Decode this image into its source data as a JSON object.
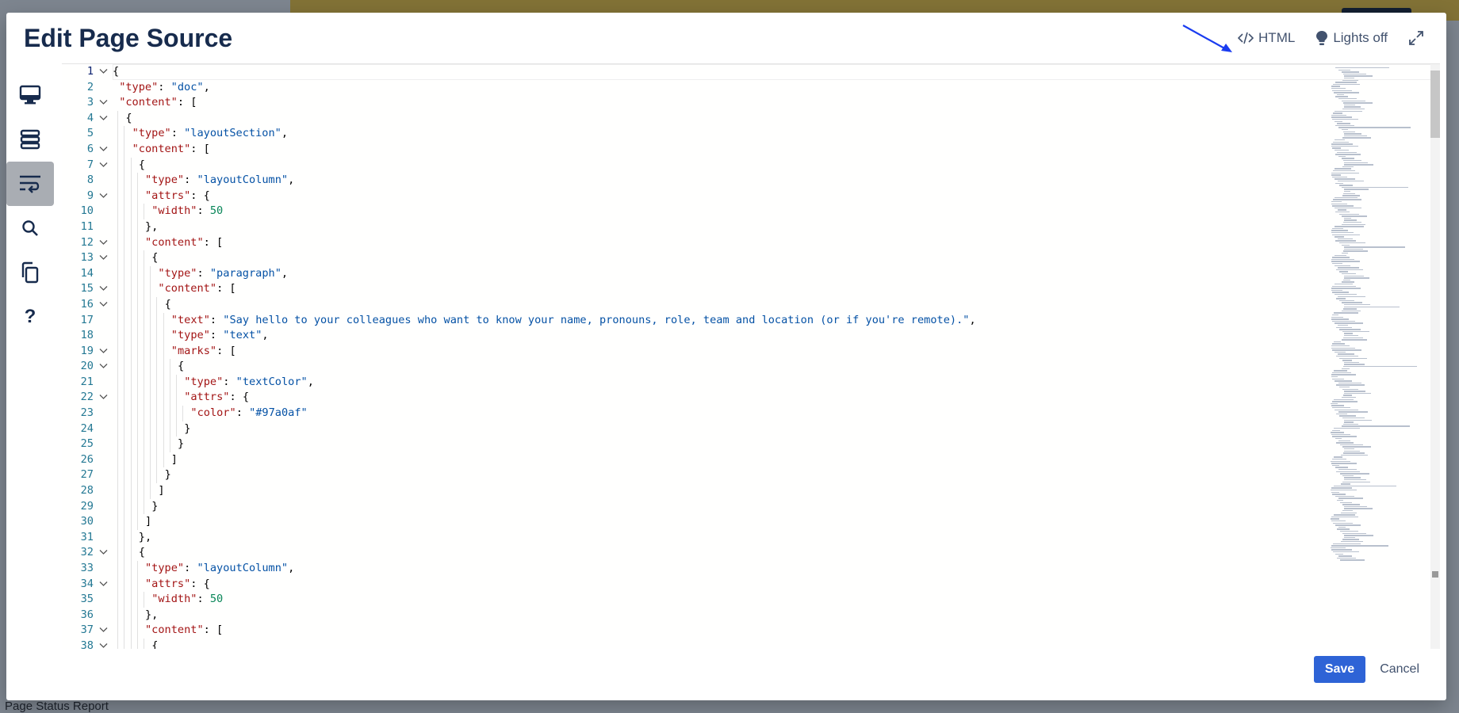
{
  "background": {
    "status_report": "Page Status Report"
  },
  "modal": {
    "title": "Edit Page Source",
    "header": {
      "html_label": "HTML",
      "lights_label": "Lights off"
    },
    "footer": {
      "save_label": "Save",
      "cancel_label": "Cancel"
    }
  },
  "toolbar": {
    "help_label": "?",
    "active_tool": "word-wrap"
  },
  "editor": {
    "current_line": 1,
    "lines": [
      {
        "n": "1",
        "fold": true,
        "text": "{"
      },
      {
        "n": "2",
        "fold": false,
        "text": "  \"type\": \"doc\","
      },
      {
        "n": "3",
        "fold": true,
        "text": "  \"content\": ["
      },
      {
        "n": "4",
        "fold": true,
        "text": "    {"
      },
      {
        "n": "5",
        "fold": false,
        "text": "      \"type\": \"layoutSection\","
      },
      {
        "n": "6",
        "fold": true,
        "text": "      \"content\": ["
      },
      {
        "n": "7",
        "fold": true,
        "text": "        {"
      },
      {
        "n": "8",
        "fold": false,
        "text": "          \"type\": \"layoutColumn\","
      },
      {
        "n": "9",
        "fold": true,
        "text": "          \"attrs\": {"
      },
      {
        "n": "10",
        "fold": false,
        "text": "            \"width\": 50"
      },
      {
        "n": "11",
        "fold": false,
        "text": "          },"
      },
      {
        "n": "12",
        "fold": true,
        "text": "          \"content\": ["
      },
      {
        "n": "13",
        "fold": true,
        "text": "            {"
      },
      {
        "n": "14",
        "fold": false,
        "text": "              \"type\": \"paragraph\","
      },
      {
        "n": "15",
        "fold": true,
        "text": "              \"content\": ["
      },
      {
        "n": "16",
        "fold": true,
        "text": "                {"
      },
      {
        "n": "17",
        "fold": false,
        "text": "                  \"text\": \"Say hello to your colleagues who want to know your name, pronouns, role, team and location (or if you're remote).\","
      },
      {
        "n": "18",
        "fold": false,
        "text": "                  \"type\": \"text\","
      },
      {
        "n": "19",
        "fold": true,
        "text": "                  \"marks\": ["
      },
      {
        "n": "20",
        "fold": true,
        "text": "                    {"
      },
      {
        "n": "21",
        "fold": false,
        "text": "                      \"type\": \"textColor\","
      },
      {
        "n": "22",
        "fold": true,
        "text": "                      \"attrs\": {"
      },
      {
        "n": "23",
        "fold": false,
        "text": "                        \"color\": \"#97a0af\""
      },
      {
        "n": "24",
        "fold": false,
        "text": "                      }"
      },
      {
        "n": "25",
        "fold": false,
        "text": "                    }"
      },
      {
        "n": "26",
        "fold": false,
        "text": "                  ]"
      },
      {
        "n": "27",
        "fold": false,
        "text": "                }"
      },
      {
        "n": "28",
        "fold": false,
        "text": "              ]"
      },
      {
        "n": "29",
        "fold": false,
        "text": "            }"
      },
      {
        "n": "30",
        "fold": false,
        "text": "          ]"
      },
      {
        "n": "31",
        "fold": false,
        "text": "        },"
      },
      {
        "n": "32",
        "fold": true,
        "text": "        {"
      },
      {
        "n": "33",
        "fold": false,
        "text": "          \"type\": \"layoutColumn\","
      },
      {
        "n": "34",
        "fold": true,
        "text": "          \"attrs\": {"
      },
      {
        "n": "35",
        "fold": false,
        "text": "            \"width\": 50"
      },
      {
        "n": "36",
        "fold": false,
        "text": "          },"
      },
      {
        "n": "37",
        "fold": true,
        "text": "          \"content\": ["
      },
      {
        "n": "38",
        "fold": true,
        "text": "            {"
      }
    ]
  }
}
